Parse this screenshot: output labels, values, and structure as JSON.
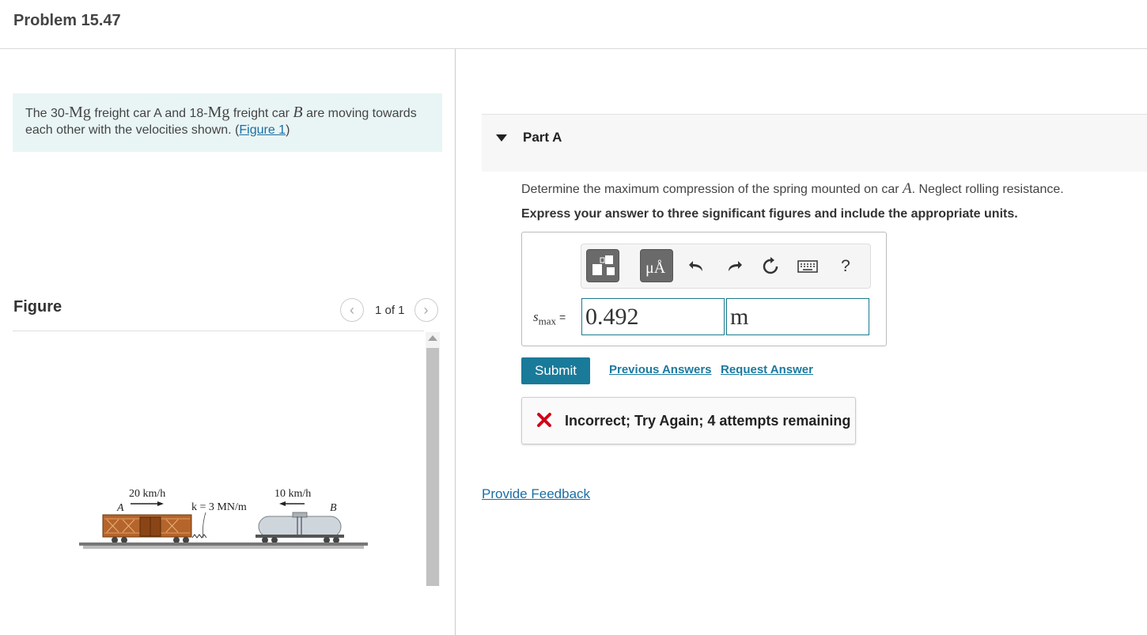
{
  "header": {
    "title": "Problem 15.47"
  },
  "intro": {
    "text_before_mass1": "The 30-",
    "mass_unit": "Mg",
    "text_car_a": " freight car A and 18-",
    "text_car": " freight car ",
    "car_b": "B",
    "text_rest": " are moving towards each other with the velocities shown. (",
    "figure_link": "Figure 1",
    "text_close": ")"
  },
  "figure": {
    "label": "Figure",
    "pager_text": "1 of 1",
    "prev_icon": "chevron-left-icon",
    "next_icon": "chevron-right-icon",
    "speed_a": "20 km/h",
    "speed_b": "10 km/h",
    "spring": "k = 3 MN/m",
    "car_a_label": "A",
    "car_b_label": "B"
  },
  "part": {
    "title": "Part A",
    "question_before": "Determine the maximum compression of the spring mounted on car ",
    "question_var": "A",
    "question_after": ". Neglect rolling resistance.",
    "instruction": "Express your answer to three significant figures and include the appropriate units."
  },
  "toolbar": {
    "templates_icon": "templates-icon",
    "units_icon": "units-icon",
    "units_text": "μÅ",
    "undo_icon": "undo-icon",
    "redo_icon": "redo-icon",
    "reset_icon": "reset-icon",
    "keyboard_icon": "keyboard-icon",
    "help_text": "?"
  },
  "answer": {
    "var_main": "s",
    "var_sub": "max",
    "equals": "=",
    "value": "0.492",
    "unit": "m"
  },
  "actions": {
    "submit": "Submit",
    "previous_answers": "Previous Answers",
    "request_answer": "Request Answer"
  },
  "feedback": {
    "icon": "incorrect-x-icon",
    "message": "Incorrect; Try Again; 4 attempts remaining",
    "color": "#d0021b"
  },
  "footer": {
    "provide_feedback": "Provide Feedback"
  },
  "colors": {
    "accent": "#1a7a9a",
    "link": "#1a6ea5",
    "intro_bg": "#e9f5f5"
  }
}
